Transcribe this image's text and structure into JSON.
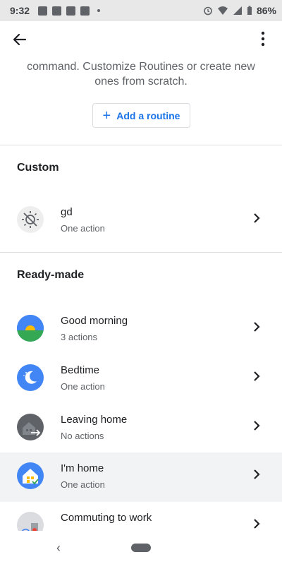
{
  "status": {
    "time": "9:32",
    "battery": "86%"
  },
  "intro_text_line1": "command. Customize Routines or create new",
  "intro_text_line2": "ones from scratch.",
  "add_routine_label": "Add a routine",
  "custom": {
    "title": "Custom",
    "items": [
      {
        "title": "gd",
        "subtitle": "One action",
        "icon": "sun-settings-icon"
      }
    ]
  },
  "readymade": {
    "title": "Ready-made",
    "items": [
      {
        "title": "Good morning",
        "subtitle": "3 actions",
        "icon": "sunrise-icon"
      },
      {
        "title": "Bedtime",
        "subtitle": "One action",
        "icon": "moon-icon"
      },
      {
        "title": "Leaving home",
        "subtitle": "No actions",
        "icon": "leaving-home-icon"
      },
      {
        "title": "I'm home",
        "subtitle": "One action",
        "icon": "home-icon"
      },
      {
        "title": "Commuting to work",
        "subtitle": "",
        "icon": "commute-icon"
      }
    ]
  },
  "colors": {
    "accent": "#1a73e8",
    "divider": "#e0e0e0",
    "highlight": "#f1f3f4"
  }
}
